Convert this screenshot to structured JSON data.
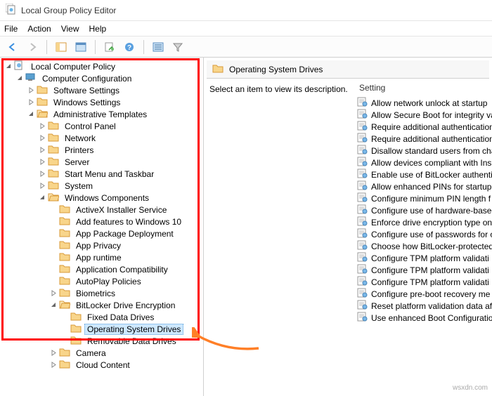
{
  "window": {
    "title": "Local Group Policy Editor"
  },
  "menu": {
    "file": "File",
    "action": "Action",
    "view": "View",
    "help": "Help"
  },
  "toolbar": {
    "back": "back",
    "fwd": "forward",
    "up": "up",
    "props": "properties",
    "refresh": "refresh",
    "export": "export",
    "help": "help",
    "filter_opts": "filter-options",
    "filter": "filter"
  },
  "tree": {
    "root": "Local Computer Policy",
    "cc": "Computer Configuration",
    "ss": "Software Settings",
    "ws": "Windows Settings",
    "at": "Administrative Templates",
    "cp": "Control Panel",
    "nw": "Network",
    "pr": "Printers",
    "sv": "Server",
    "smt": "Start Menu and Taskbar",
    "sys": "System",
    "wc": "Windows Components",
    "ax": "ActiveX Installer Service",
    "af": "Add features to Windows 10",
    "apd": "App Package Deployment",
    "apv": "App Privacy",
    "art": "App runtime",
    "acm": "Application Compatibility",
    "apl": "AutoPlay Policies",
    "bio": "Biometrics",
    "bde": "BitLocker Drive Encryption",
    "fdd": "Fixed Data Drives",
    "osd": "Operating System Drives",
    "rdd": "Removable Data Drives",
    "cam": "Camera",
    "cld": "Cloud Content"
  },
  "right": {
    "header": "Operating System Drives",
    "desc": "Select an item to view its description.",
    "setting_col": "Setting",
    "settings": [
      "Allow network unlock at startup",
      "Allow Secure Boot for integrity va",
      "Require additional authentication",
      "Require additional authentication",
      "Disallow standard users from cha",
      "Allow devices compliant with Ins",
      "Enable use of BitLocker authentic",
      "Allow enhanced PINs for startup",
      "Configure minimum PIN length f",
      "Configure use of hardware-based",
      "Enforce drive encryption type on",
      "Configure use of passwords for o",
      "Choose how BitLocker-protected",
      "Configure TPM platform validati",
      "Configure TPM platform validati",
      "Configure TPM platform validati",
      "Configure pre-boot recovery me",
      "Reset platform validation data af",
      "Use enhanced Boot Configuratio"
    ]
  },
  "watermark": "wsxdn.com"
}
